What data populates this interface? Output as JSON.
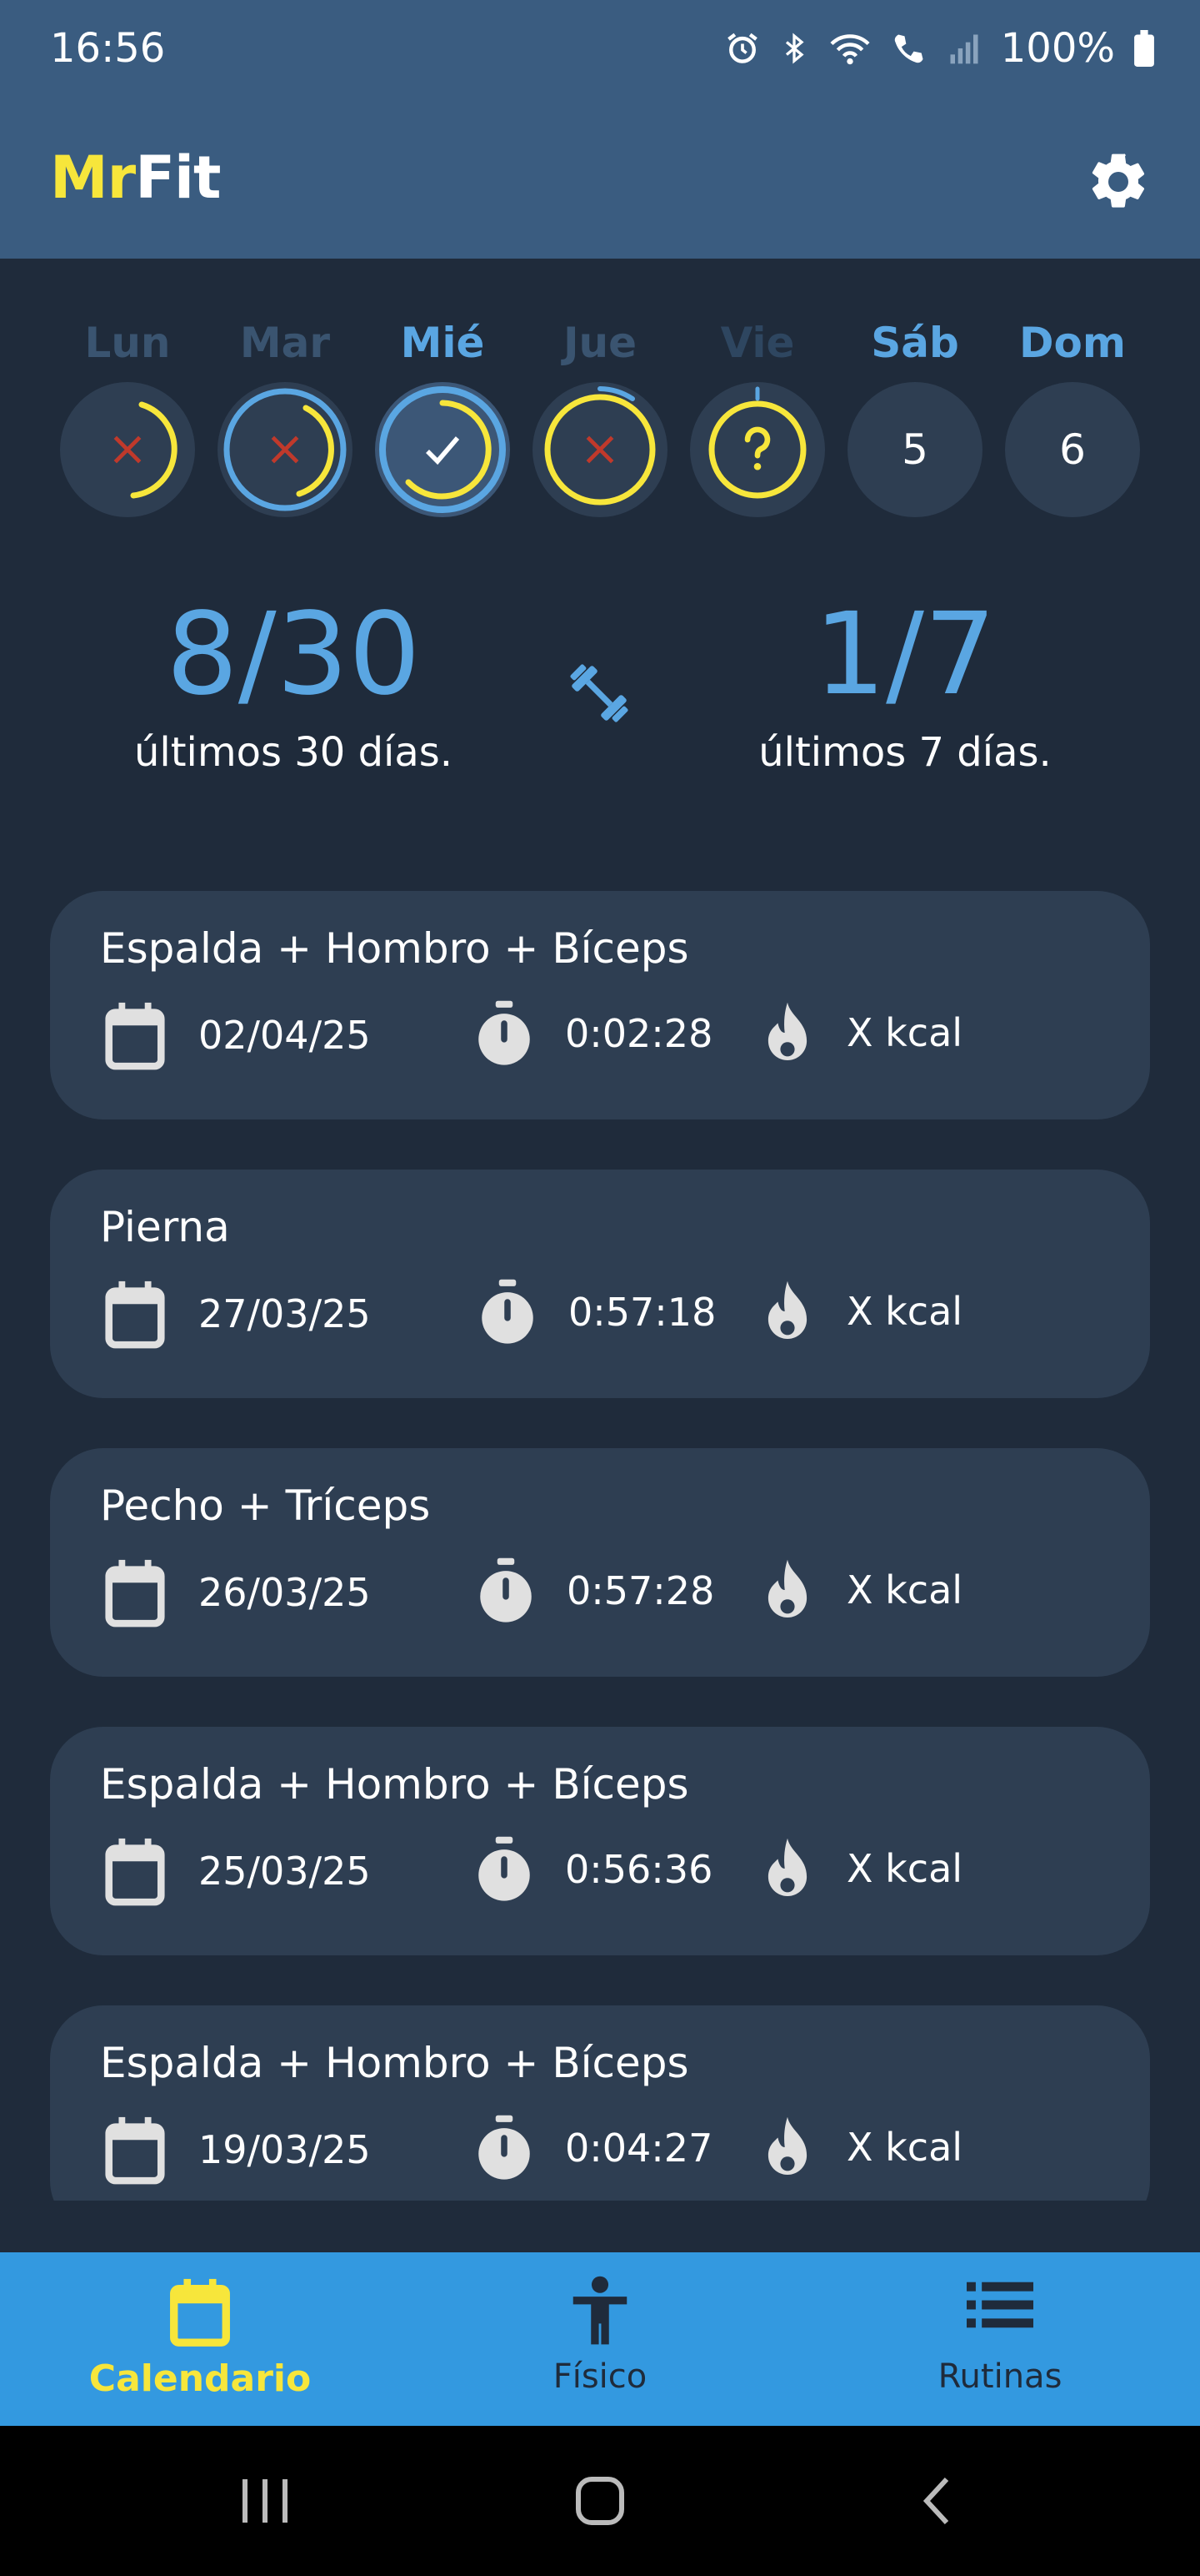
{
  "status_bar": {
    "time": "16:56",
    "battery": "100%"
  },
  "app": {
    "title_part1": "Mr",
    "title_part2": "Fit"
  },
  "week": {
    "days": [
      {
        "label": "Lun",
        "state": "missed",
        "ring": "yellow-partial"
      },
      {
        "label": "Mar",
        "state": "missed",
        "ring": "blue-yellow"
      },
      {
        "label": "Mié",
        "state": "done",
        "ring": "blue-yellow"
      },
      {
        "label": "Jue",
        "state": "missed",
        "ring": "yellow"
      },
      {
        "label": "Vie",
        "state": "pending",
        "ring": "yellow"
      },
      {
        "label": "Sáb",
        "state": "future",
        "number": "5"
      },
      {
        "label": "Dom",
        "state": "future",
        "number": "6"
      }
    ]
  },
  "stats": {
    "month": {
      "value": "8/30",
      "caption": "últimos 30 días."
    },
    "week": {
      "value": "1/7",
      "caption": "últimos 7 días."
    }
  },
  "workouts": [
    {
      "title": "Espalda + Hombro + Bíceps",
      "date": "02/04/25",
      "duration": "0:02:28",
      "kcal": "X kcal"
    },
    {
      "title": "Pierna",
      "date": "27/03/25",
      "duration": "0:57:18",
      "kcal": "X kcal"
    },
    {
      "title": "Pecho + Tríceps",
      "date": "26/03/25",
      "duration": "0:57:28",
      "kcal": "X kcal"
    },
    {
      "title": "Espalda + Hombro + Bíceps",
      "date": "25/03/25",
      "duration": "0:56:36",
      "kcal": "X kcal"
    },
    {
      "title": "Espalda + Hombro + Bíceps",
      "date": "19/03/25",
      "duration": "0:04:27",
      "kcal": "X kcal"
    }
  ],
  "bottom_nav": [
    {
      "label": "Calendario",
      "icon": "calendar-icon",
      "active": true
    },
    {
      "label": "Físico",
      "icon": "person-icon",
      "active": false
    },
    {
      "label": "Rutinas",
      "icon": "list-icon",
      "active": false
    }
  ],
  "colors": {
    "header": "#3a5c80",
    "background": "#1f2b3b",
    "card": "#2e3e52",
    "accent_blue": "#5aa6e2",
    "accent_yellow": "#f7e63b",
    "nav": "#3399e0",
    "missed_red": "#c0392b"
  }
}
